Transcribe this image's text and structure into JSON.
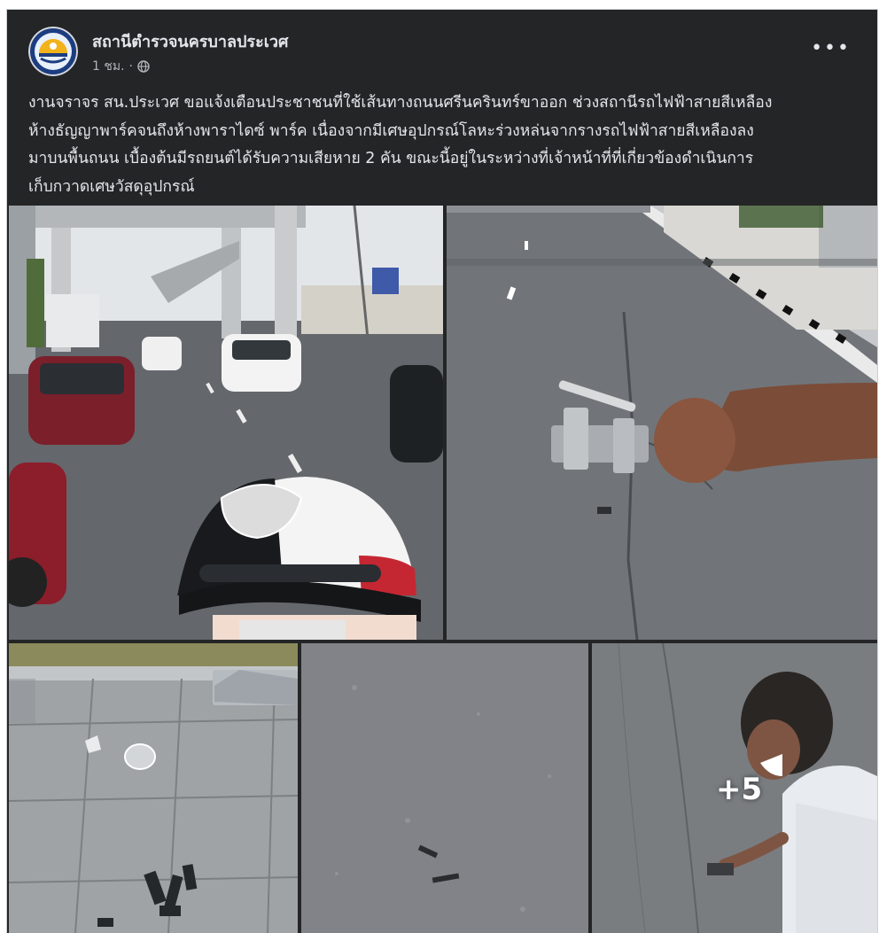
{
  "post": {
    "page_name": "สถานีตำรวจนครบาลประเวศ",
    "time": "1 ชม.",
    "separator": "·",
    "privacy_icon": "globe-icon",
    "more_icon": "more-options-icon",
    "more_label": "•••",
    "text_lines": [
      "งานจราจร สน.ประเวศ ขอแจ้งเตือนประชาชนที่ใช้เส้นทางถนนศรีนครินทร์ขาออก ช่วงสถานีรถไฟฟ้าสายสีเหลือง",
      "ห้างธัญญาพาร์คจนถึงห้างพาราไดซ์ พาร์ค เนื่องจากมีเศษอุปกรณ์โลหะร่วงหล่นจากรางรถไฟฟ้าสายสีเหลืองลง",
      "มาบนพื้นถนน เบื้องต้นมีรถยนต์ได้รับความเสียหาย 2 คัน ขณะนี้อยู่ในระหว่างที่เจ้าหน้าที่ที่เกี่ยวข้องดำเนินการ",
      "เก็บกวาดเศษวัสดุอุปกรณ์"
    ]
  },
  "photos": {
    "more_count": "+5"
  },
  "colors": {
    "card_bg": "#242526",
    "text_primary": "#e4e6eb",
    "text_secondary": "#b0b3b8"
  }
}
